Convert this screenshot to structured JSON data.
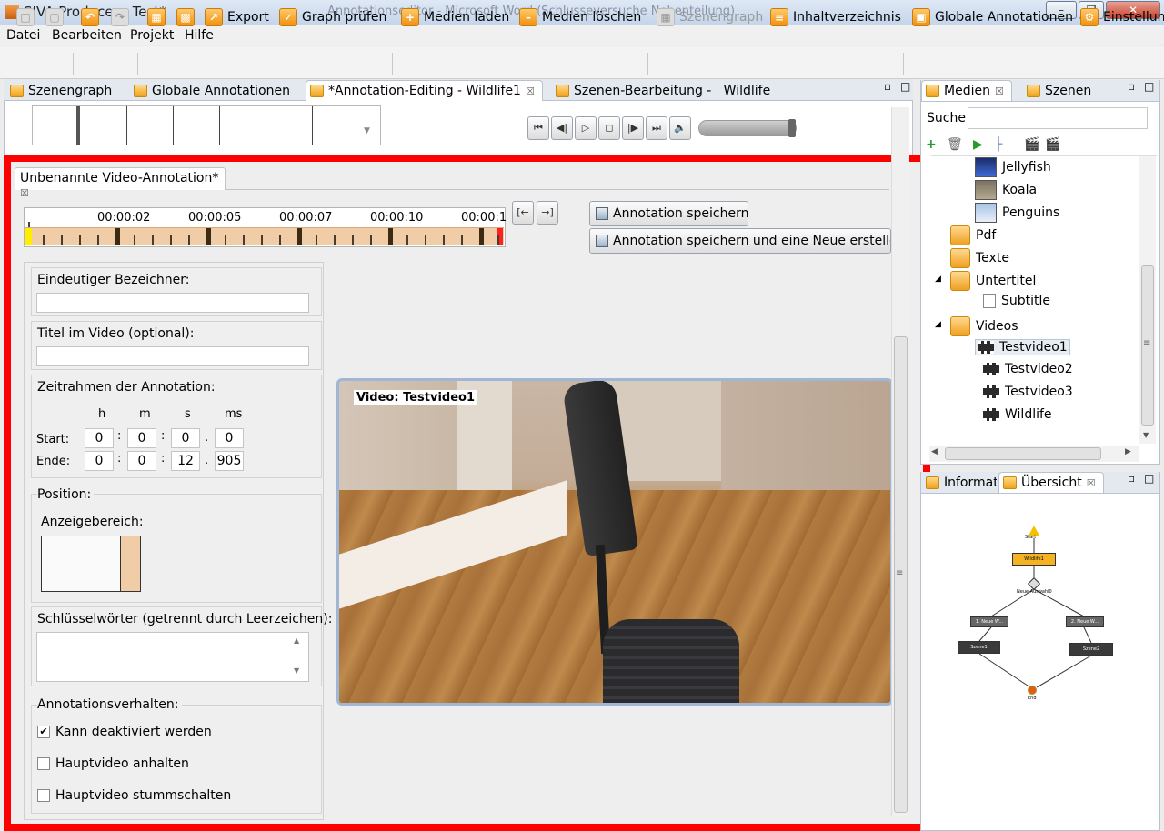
{
  "window": {
    "title": "SIVA Producer - Test*",
    "bg_title": "Annotationseditor - Microsoft Word (Schlusseversuche Nebenteilung)"
  },
  "menu": [
    "Datei",
    "Bearbeiten",
    "Projekt",
    "Hilfe"
  ],
  "toolbar": {
    "export": "Export",
    "graph_pruefen": "Graph prüfen",
    "medien_laden": "Medien laden",
    "medien_loeschen": "Medien löschen",
    "szenengraph": "Szenengraph",
    "inhaltsverzeichnis": "Inhaltverzeichnis",
    "globale_annotationen": "Globale Annotationen",
    "einstellungen": "Einstellung"
  },
  "editor_tabs": [
    {
      "label": "Szenengraph"
    },
    {
      "label": "Globale Annotationen"
    },
    {
      "label": "*Annotation-Editing - Wildlife1"
    },
    {
      "label": "Szenen-Bearbeitung -   Wildlife"
    }
  ],
  "annotation_tab": "Unbenannte Video-Annotation*",
  "timeline": {
    "labels": [
      "00:00:02",
      "00:00:05",
      "00:00:07",
      "00:00:10",
      "00:00:1"
    ]
  },
  "buttons": {
    "save": "Annotation speichern",
    "save_new": "Annotation speichern und eine Neue erstellen"
  },
  "form": {
    "id_label": "Eindeutiger Bezeichner:",
    "id_value": "",
    "title_label": "Titel im Video (optional):",
    "title_value": "",
    "time_label": "Zeitrahmen der Annotation:",
    "cols": [
      "h",
      "m",
      "s",
      "ms"
    ],
    "start_label": "Start:",
    "end_label": "Ende:",
    "start": [
      "0",
      "0",
      "0",
      "0"
    ],
    "end": [
      "0",
      "0",
      "12",
      "905"
    ],
    "position_label": "Position:",
    "display_label": "Anzeigebereich:",
    "keywords_label": "Schlüsselwörter (getrennt durch Leerzeichen):",
    "keywords_value": "",
    "behavior_label": "Annotationsverhalten:",
    "checkboxes": [
      {
        "label": "Kann deaktiviert werden",
        "checked": true
      },
      {
        "label": "Hauptvideo anhalten",
        "checked": false
      },
      {
        "label": "Hauptvideo stummschalten",
        "checked": false
      }
    ]
  },
  "video": {
    "caption": "Video: Testvideo1"
  },
  "media_panel": {
    "tabs": [
      "Medien",
      "Szenen"
    ],
    "search_label": "Suche",
    "search_value": "",
    "tree": {
      "images": [
        "Jellyfish",
        "Koala",
        "Penguins"
      ],
      "pdf": "Pdf",
      "texte": "Texte",
      "untertitel": "Untertitel",
      "subtitle": "Subtitle",
      "videos": "Videos",
      "video_items": [
        "Testvideo1",
        "Testvideo2",
        "Testvideo3",
        "Wildlife"
      ]
    }
  },
  "overview_panel": {
    "tabs": [
      "Informat",
      "Übersicht"
    ],
    "graph": {
      "start": "Start",
      "scene": "Wildlife1",
      "fork": "Neue Auswahl0",
      "branches": [
        "1. Neue W...",
        "2. Neue W..."
      ],
      "scenes": [
        "Szene1",
        "Szene2"
      ],
      "end": "End"
    }
  },
  "colors": {
    "accent_red": "#ff0000",
    "timeline_fill": "#f0cca7",
    "start_marker": "#ffee00",
    "end_marker": "#ff2020"
  }
}
